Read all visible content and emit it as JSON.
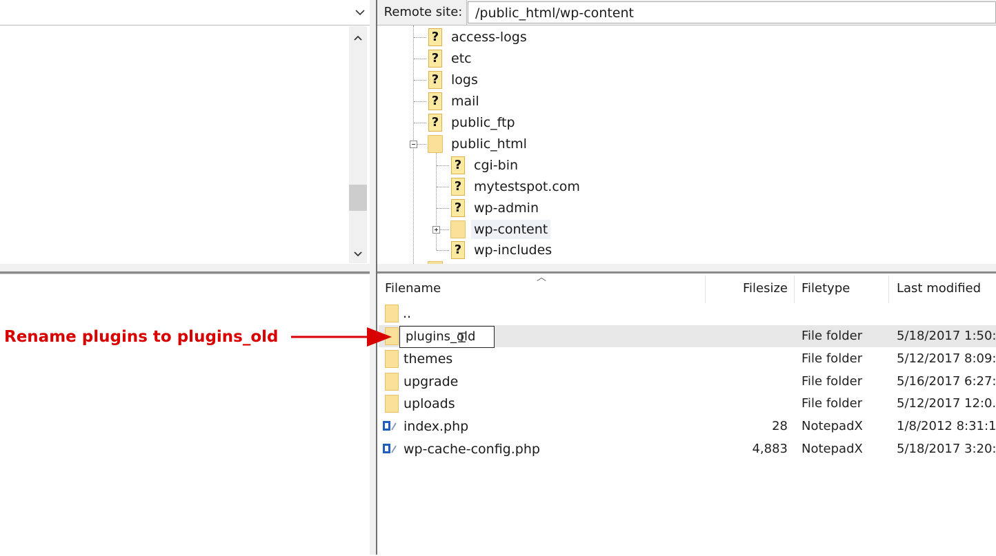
{
  "remote": {
    "site_label": "Remote site:",
    "path": "/public_html/wp-content"
  },
  "tree": {
    "items": [
      {
        "label": "access-logs",
        "icon": "unknown-folder-icon"
      },
      {
        "label": "etc",
        "icon": "unknown-folder-icon"
      },
      {
        "label": "logs",
        "icon": "unknown-folder-icon"
      },
      {
        "label": "mail",
        "icon": "unknown-folder-icon"
      },
      {
        "label": "public_ftp",
        "icon": "unknown-folder-icon"
      },
      {
        "label": "public_html",
        "icon": "folder-icon",
        "expanded": true
      },
      {
        "label": "cgi-bin",
        "icon": "unknown-folder-icon"
      },
      {
        "label": "mytestspot.com",
        "icon": "unknown-folder-icon"
      },
      {
        "label": "wp-admin",
        "icon": "unknown-folder-icon"
      },
      {
        "label": "wp-content",
        "icon": "folder-icon",
        "selected": true
      },
      {
        "label": "wp-includes",
        "icon": "unknown-folder-icon"
      }
    ]
  },
  "file_list": {
    "columns": {
      "filename": "Filename",
      "filesize": "Filesize",
      "filetype": "Filetype",
      "last_modified": "Last modified"
    },
    "parent_entry": "..",
    "rename_value": "plugins_old",
    "rows": [
      {
        "name": "",
        "size": "",
        "type": "File folder",
        "modified": "5/18/2017 1:50:..",
        "icon": "folder-icon"
      },
      {
        "name": "themes",
        "size": "",
        "type": "File folder",
        "modified": "5/12/2017 8:09:..",
        "icon": "folder-icon"
      },
      {
        "name": "upgrade",
        "size": "",
        "type": "File folder",
        "modified": "5/16/2017 6:27:..",
        "icon": "folder-icon"
      },
      {
        "name": "uploads",
        "size": "",
        "type": "File folder",
        "modified": "5/12/2017 12:0...",
        "icon": "folder-icon"
      },
      {
        "name": "index.php",
        "size": "28",
        "type": "NotepadX",
        "modified": "1/8/2012 8:31:1..",
        "icon": "php-file-icon"
      },
      {
        "name": "wp-cache-config.php",
        "size": "4,883",
        "type": "NotepadX",
        "modified": "5/18/2017 3:20:..",
        "icon": "php-file-icon"
      }
    ]
  },
  "annotation": {
    "text": "Rename plugins to plugins_old",
    "color": "#d90000"
  }
}
